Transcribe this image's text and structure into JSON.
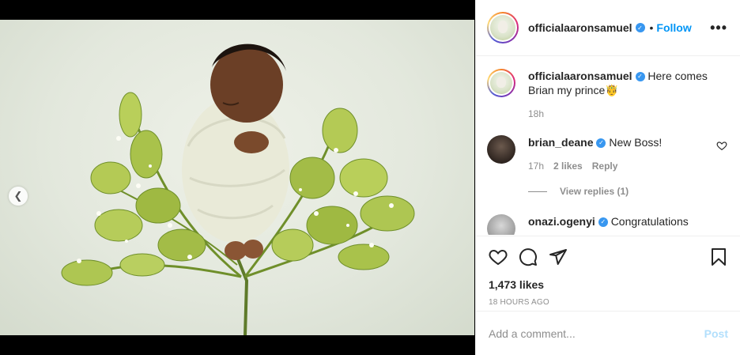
{
  "post": {
    "username": "officialaaronsamuel",
    "follow_label": "Follow",
    "separator": "•",
    "more_icon": "more-horizontal-icon",
    "image_alt": "Newborn baby wrapped in cream blanket sleeping among green flower sprigs",
    "carousel": {
      "active_index": 1,
      "count": 2
    }
  },
  "caption": {
    "username": "officialaaronsamuel",
    "text": "Here comes Brian my prince🤴",
    "time": "18h"
  },
  "comments": [
    {
      "username": "brian_deane",
      "text": "New Boss!",
      "time": "17h",
      "likes": "2 likes",
      "reply_label": "Reply",
      "view_replies": "View replies (1)"
    },
    {
      "username": "onazi.ogenyi",
      "text": "Congratulations"
    }
  ],
  "engagement": {
    "likes": "1,473 likes",
    "timestamp": "18 HOURS AGO"
  },
  "composer": {
    "placeholder": "Add a comment...",
    "post_label": "Post"
  },
  "colors": {
    "accent": "#0095f6",
    "verified": "#3897f0",
    "muted": "#8e8e8e",
    "post_disabled": "#b2dffc"
  }
}
